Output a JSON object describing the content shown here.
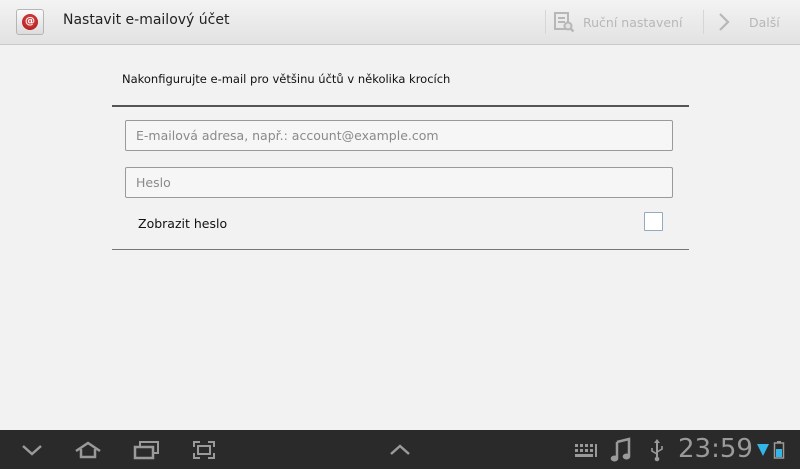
{
  "actionbar": {
    "title": "Nastavit e-mailový účet",
    "manual_label": "Ruční nastavení",
    "next_label": "Další",
    "app_icon_glyph": "@"
  },
  "form": {
    "instructions": "Nakonfigurujte e-mail pro většinu účtů v několika krocích",
    "email_placeholder": "E-mailová adresa, např.: account@example.com",
    "password_placeholder": "Heslo",
    "show_password_label": "Zobrazit heslo"
  },
  "systembar": {
    "time": "23:59",
    "icons": [
      "back-icon",
      "home-icon",
      "recent-apps-icon",
      "screenshot-icon",
      "chevron-up-icon",
      "keyboard-icon",
      "music-note-icon",
      "usb-icon",
      "wifi-icon",
      "battery-icon"
    ]
  },
  "colors": {
    "actionbar_bg": "#ebebeb",
    "page_bg": "#f2f2f2",
    "systembar_bg": "#2a2a2a",
    "accent_blue": "#33b5e5"
  }
}
